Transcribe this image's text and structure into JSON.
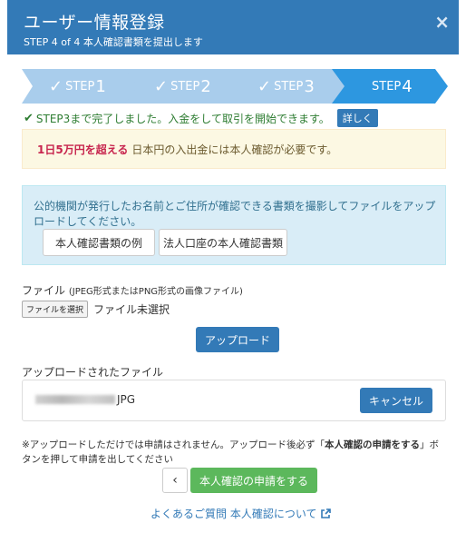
{
  "header": {
    "title": "ユーザー情報登録",
    "subtitle": "STEP 4 of 4 本人確認書類を提出します",
    "close": "×"
  },
  "steps": [
    {
      "prefix": "STEP",
      "num": "1",
      "done": true,
      "active": false
    },
    {
      "prefix": "STEP",
      "num": "2",
      "done": true,
      "active": false
    },
    {
      "prefix": "STEP",
      "num": "3",
      "done": true,
      "active": false
    },
    {
      "prefix": "STEP",
      "num": "4",
      "done": false,
      "active": true
    }
  ],
  "status": {
    "text": "STEP3まで完了しました。入金をして取引を開始できます。",
    "detail_label": "詳しく"
  },
  "warning": {
    "emphasis": "1日5万円を超える",
    "text": "日本円の入出金には本人確認が必要です。"
  },
  "info": {
    "text": "公的機関が発行したお名前とご住所が確認できる書類を撮影してファイルをアップロードしてください。",
    "example_button": "本人確認書類の例",
    "corporate_button": "法人口座の本人確認書類"
  },
  "file": {
    "label": "ファイル",
    "hint": "(JPEG形式またはPNG形式の画像ファイル)",
    "choose_button": "ファイルを選択",
    "no_file": "ファイル未選択",
    "upload_button": "アップロード"
  },
  "uploaded": {
    "label": "アップロードされたファイル",
    "filename_ext": "JPG",
    "cancel_button": "キャンセル"
  },
  "note": {
    "part1": "※アップロードしただけでは申請はされません。アップロード後必ず「",
    "bold": "本人確認の申請をする",
    "part2": "」ボタンを押して申請を出してください"
  },
  "actions": {
    "back": "‹",
    "apply": "本人確認の申請をする"
  },
  "faq": {
    "label": "よくあるご質問 本人確認について"
  },
  "colors": {
    "primary": "#337ab7",
    "step_inactive": "#a9cdec",
    "step_active": "#2d97e0",
    "success": "#5cb85c"
  }
}
